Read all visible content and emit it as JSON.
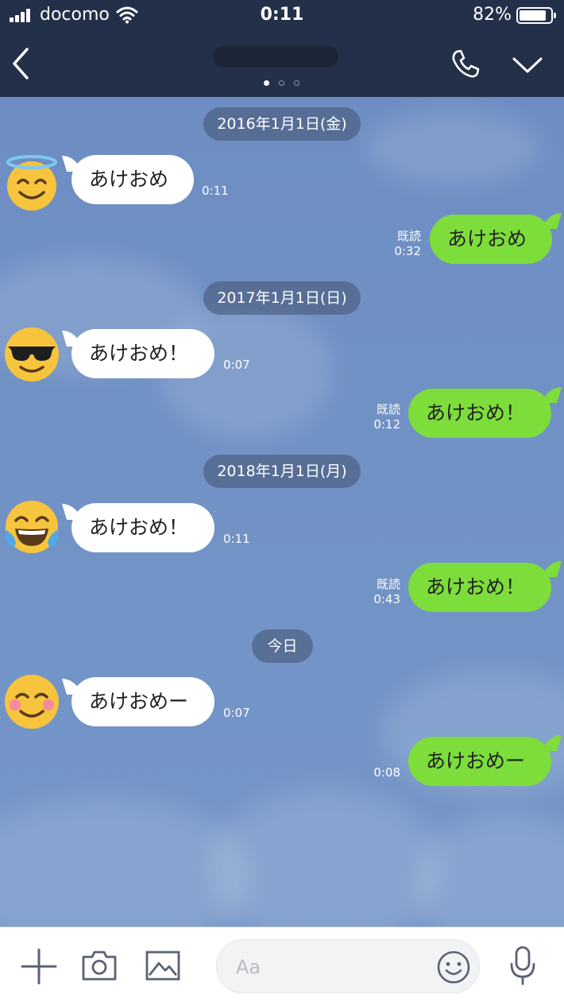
{
  "status_bar": {
    "carrier": "docomo",
    "time": "0:11",
    "battery_percent": "82%",
    "battery_level": 0.82,
    "icons": [
      "signal-icon",
      "wifi-icon",
      "battery-icon"
    ]
  },
  "header": {
    "back_icon": "chevron-left-icon",
    "chat_title": "",
    "page_indicator": {
      "count": 3,
      "active": 0
    },
    "call_icon": "phone-icon",
    "menu_icon": "chevron-down-icon"
  },
  "messages": {
    "date_2016": "2016年1月1日(金)",
    "m1": {
      "text": "あけおめ",
      "time": "0:11",
      "avatar": "halo-smile-emoji"
    },
    "m2": {
      "text": "あけおめ",
      "read": "既読",
      "time": "0:32"
    },
    "date_2017": "2017年1月1日(日)",
    "m3": {
      "text": "あけおめ！",
      "time": "0:07",
      "avatar": "sunglasses-emoji"
    },
    "m4": {
      "text": "あけおめ！",
      "read": "既読",
      "time": "0:12"
    },
    "date_2018": "2018年1月1日(月)",
    "m5": {
      "text": "あけおめ！",
      "time": "0:11",
      "avatar": "tears-of-joy-emoji"
    },
    "m6": {
      "text": "あけおめ！",
      "read": "既読",
      "time": "0:43"
    },
    "date_today": "今日",
    "m7": {
      "text": "あけおめー",
      "time": "0:07",
      "avatar": "blush-smile-emoji"
    },
    "m8": {
      "text": "あけおめー",
      "time": "0:08"
    }
  },
  "input_bar": {
    "placeholder": "Aa",
    "icons": [
      "plus-icon",
      "camera-icon",
      "image-icon",
      "emoji-icon",
      "microphone-icon"
    ]
  },
  "colors": {
    "header_bg": "#23304a",
    "chat_bg": "#7192c5",
    "outgoing_bubble": "#7ddd3b",
    "incoming_bubble": "#ffffff",
    "date_pill": "#4e6185"
  }
}
